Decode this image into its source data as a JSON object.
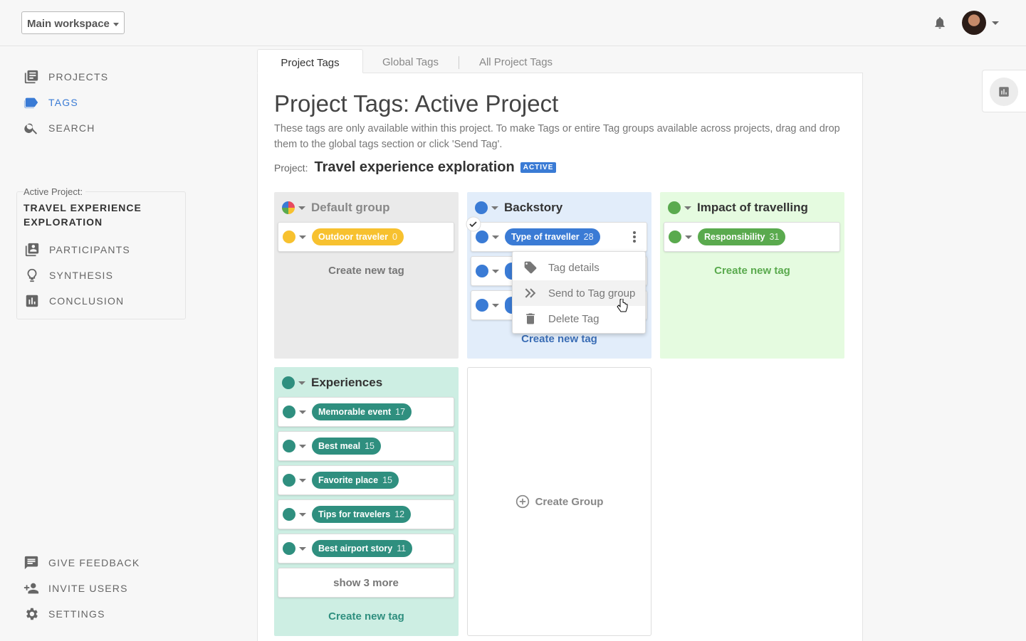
{
  "header": {
    "workspace": "Main workspace"
  },
  "sidebar": {
    "nav": [
      {
        "label": "PROJECTS",
        "icon": "projects-icon"
      },
      {
        "label": "TAGS",
        "icon": "tag-icon"
      },
      {
        "label": "SEARCH",
        "icon": "search-icon"
      }
    ],
    "active_project_label": "Active Project:",
    "active_project_name": "TRAVEL EXPERIENCE EXPLORATION",
    "project_nav": [
      {
        "label": "PARTICIPANTS",
        "icon": "participants-icon"
      },
      {
        "label": "SYNTHESIS",
        "icon": "lightbulb-icon"
      },
      {
        "label": "CONCLUSION",
        "icon": "chart-icon"
      }
    ],
    "bottom": [
      {
        "label": "GIVE FEEDBACK",
        "icon": "feedback-icon"
      },
      {
        "label": "INVITE USERS",
        "icon": "add-user-icon"
      },
      {
        "label": "SETTINGS",
        "icon": "gear-icon"
      }
    ]
  },
  "tabs": [
    "Project Tags",
    "Global Tags",
    "All Project Tags"
  ],
  "page": {
    "title": "Project Tags: Active Project",
    "description": "These tags are only available within this project. To make Tags or entire Tag groups available across projects, drag and drop them to the global tags section or click 'Send Tag'.",
    "project_label": "Project:",
    "project_name": "Travel experience exploration",
    "active_badge": "ACTIVE"
  },
  "groups": {
    "default": {
      "name": "Default group",
      "tags": [
        {
          "label": "Outdoor traveler",
          "count": "0"
        }
      ],
      "create": "Create new tag"
    },
    "backstory": {
      "name": "Backstory",
      "tags": [
        {
          "label": "Type of traveller",
          "count": "28"
        }
      ],
      "create": "Create new tag"
    },
    "impact": {
      "name": "Impact of travelling",
      "tags": [
        {
          "label": "Responsibility",
          "count": "31"
        }
      ],
      "create": "Create new tag"
    },
    "experiences": {
      "name": "Experiences",
      "tags": [
        {
          "label": "Memorable event",
          "count": "17"
        },
        {
          "label": "Best meal",
          "count": "15"
        },
        {
          "label": "Favorite place",
          "count": "15"
        },
        {
          "label": "Tips for travelers",
          "count": "12"
        },
        {
          "label": "Best airport story",
          "count": "11"
        }
      ],
      "show_more": "show 3 more",
      "create": "Create new tag"
    }
  },
  "context_menu": [
    "Tag details",
    "Send to Tag group",
    "Delete Tag"
  ],
  "create_group": "Create Group",
  "colors": {
    "accent": "#3a7bd5",
    "default_tag": "#f7c12f",
    "backstory": "#3a7bd5",
    "impact": "#5aaa4e",
    "experiences": "#2f8f7f"
  }
}
